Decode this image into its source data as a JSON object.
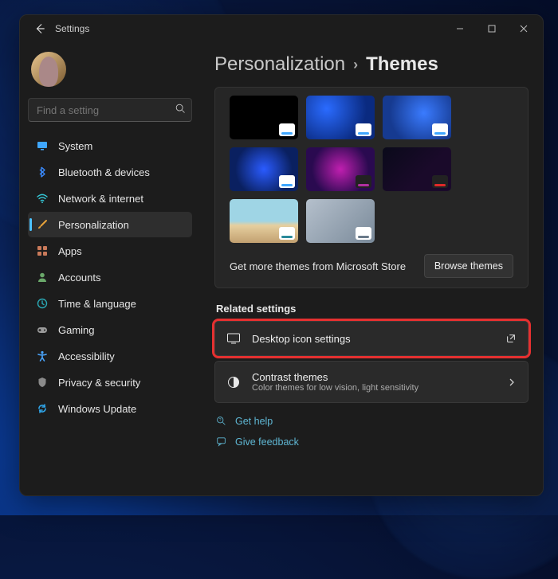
{
  "titlebar": {
    "title": "Settings"
  },
  "search": {
    "placeholder": "Find a setting"
  },
  "nav": [
    {
      "label": "System",
      "icon": "monitor",
      "color": "#3fa7ff"
    },
    {
      "label": "Bluetooth & devices",
      "icon": "bluetooth",
      "color": "#3a8bff"
    },
    {
      "label": "Network & internet",
      "icon": "wifi",
      "color": "#34c7d6"
    },
    {
      "label": "Personalization",
      "icon": "brush",
      "color": "#e8a33a",
      "active": true
    },
    {
      "label": "Apps",
      "icon": "apps",
      "color": "#c97a5a"
    },
    {
      "label": "Accounts",
      "icon": "person",
      "color": "#6aa86a"
    },
    {
      "label": "Time & language",
      "icon": "clock",
      "color": "#2aa9b5"
    },
    {
      "label": "Gaming",
      "icon": "gaming",
      "color": "#9a9a9a"
    },
    {
      "label": "Accessibility",
      "icon": "accessibility",
      "color": "#4aa6ff"
    },
    {
      "label": "Privacy & security",
      "icon": "shield",
      "color": "#8a8a8a"
    },
    {
      "label": "Windows Update",
      "icon": "update",
      "color": "#2fa3e6"
    }
  ],
  "breadcrumb": {
    "parent": "Personalization",
    "current": "Themes"
  },
  "store": {
    "text": "Get more themes from Microsoft Store",
    "button": "Browse themes"
  },
  "related": {
    "heading": "Related settings",
    "desktop_icons": {
      "title": "Desktop icon settings"
    },
    "contrast": {
      "title": "Contrast themes",
      "subtitle": "Color themes for low vision, light sensitivity"
    }
  },
  "links": {
    "help": "Get help",
    "feedback": "Give feedback"
  }
}
